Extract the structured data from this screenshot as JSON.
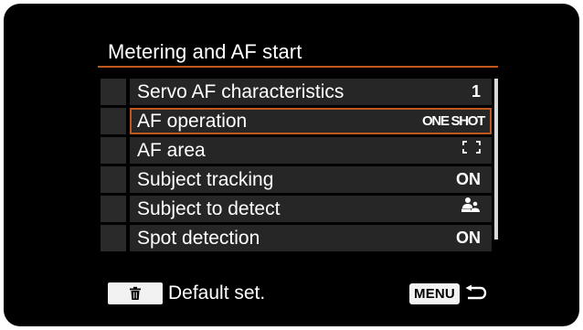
{
  "menu": {
    "title": "Metering and AF start",
    "accent_color": "#c0581e",
    "items": [
      {
        "label": "Servo AF characteristics",
        "value": "1"
      },
      {
        "label": "AF operation",
        "value": "ONE SHOT",
        "selected": true
      },
      {
        "label": "AF area",
        "value": "[ ]",
        "icon": "af-area-frame-icon"
      },
      {
        "label": "Subject tracking",
        "value": "ON"
      },
      {
        "label": "Subject to detect",
        "value": "",
        "icon": "people-detect-icon"
      },
      {
        "label": "Spot detection",
        "value": "ON"
      }
    ]
  },
  "footer": {
    "default_label": "Default set.",
    "default_icon": "trash-icon",
    "menu_key": "MENU",
    "back_icon": "return-arrow-icon"
  }
}
